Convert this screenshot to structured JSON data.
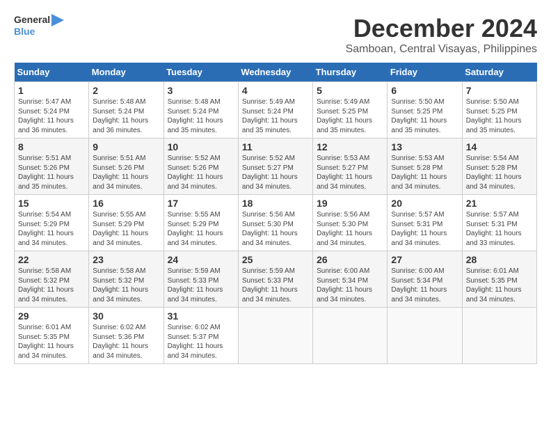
{
  "logo": {
    "text_general": "General",
    "text_blue": "Blue"
  },
  "header": {
    "title": "December 2024",
    "subtitle": "Samboan, Central Visayas, Philippines"
  },
  "calendar": {
    "days_of_week": [
      "Sunday",
      "Monday",
      "Tuesday",
      "Wednesday",
      "Thursday",
      "Friday",
      "Saturday"
    ],
    "weeks": [
      [
        {
          "day": "",
          "info": ""
        },
        {
          "day": "2",
          "info": "Sunrise: 5:48 AM\nSunset: 5:24 PM\nDaylight: 11 hours\nand 36 minutes."
        },
        {
          "day": "3",
          "info": "Sunrise: 5:48 AM\nSunset: 5:24 PM\nDaylight: 11 hours\nand 35 minutes."
        },
        {
          "day": "4",
          "info": "Sunrise: 5:49 AM\nSunset: 5:24 PM\nDaylight: 11 hours\nand 35 minutes."
        },
        {
          "day": "5",
          "info": "Sunrise: 5:49 AM\nSunset: 5:25 PM\nDaylight: 11 hours\nand 35 minutes."
        },
        {
          "day": "6",
          "info": "Sunrise: 5:50 AM\nSunset: 5:25 PM\nDaylight: 11 hours\nand 35 minutes."
        },
        {
          "day": "7",
          "info": "Sunrise: 5:50 AM\nSunset: 5:25 PM\nDaylight: 11 hours\nand 35 minutes."
        }
      ],
      [
        {
          "day": "1",
          "info": "Sunrise: 5:47 AM\nSunset: 5:24 PM\nDaylight: 11 hours\nand 36 minutes."
        },
        {
          "day": "8",
          "info": "Sunrise: 5:51 AM\nSunset: 5:26 PM\nDaylight: 11 hours\nand 35 minutes."
        },
        {
          "day": "9",
          "info": "Sunrise: 5:51 AM\nSunset: 5:26 PM\nDaylight: 11 hours\nand 34 minutes."
        },
        {
          "day": "10",
          "info": "Sunrise: 5:52 AM\nSunset: 5:26 PM\nDaylight: 11 hours\nand 34 minutes."
        },
        {
          "day": "11",
          "info": "Sunrise: 5:52 AM\nSunset: 5:27 PM\nDaylight: 11 hours\nand 34 minutes."
        },
        {
          "day": "12",
          "info": "Sunrise: 5:53 AM\nSunset: 5:27 PM\nDaylight: 11 hours\nand 34 minutes."
        },
        {
          "day": "13",
          "info": "Sunrise: 5:53 AM\nSunset: 5:28 PM\nDaylight: 11 hours\nand 34 minutes."
        },
        {
          "day": "14",
          "info": "Sunrise: 5:54 AM\nSunset: 5:28 PM\nDaylight: 11 hours\nand 34 minutes."
        }
      ],
      [
        {
          "day": "15",
          "info": "Sunrise: 5:54 AM\nSunset: 5:29 PM\nDaylight: 11 hours\nand 34 minutes."
        },
        {
          "day": "16",
          "info": "Sunrise: 5:55 AM\nSunset: 5:29 PM\nDaylight: 11 hours\nand 34 minutes."
        },
        {
          "day": "17",
          "info": "Sunrise: 5:55 AM\nSunset: 5:29 PM\nDaylight: 11 hours\nand 34 minutes."
        },
        {
          "day": "18",
          "info": "Sunrise: 5:56 AM\nSunset: 5:30 PM\nDaylight: 11 hours\nand 34 minutes."
        },
        {
          "day": "19",
          "info": "Sunrise: 5:56 AM\nSunset: 5:30 PM\nDaylight: 11 hours\nand 34 minutes."
        },
        {
          "day": "20",
          "info": "Sunrise: 5:57 AM\nSunset: 5:31 PM\nDaylight: 11 hours\nand 34 minutes."
        },
        {
          "day": "21",
          "info": "Sunrise: 5:57 AM\nSunset: 5:31 PM\nDaylight: 11 hours\nand 33 minutes."
        }
      ],
      [
        {
          "day": "22",
          "info": "Sunrise: 5:58 AM\nSunset: 5:32 PM\nDaylight: 11 hours\nand 34 minutes."
        },
        {
          "day": "23",
          "info": "Sunrise: 5:58 AM\nSunset: 5:32 PM\nDaylight: 11 hours\nand 34 minutes."
        },
        {
          "day": "24",
          "info": "Sunrise: 5:59 AM\nSunset: 5:33 PM\nDaylight: 11 hours\nand 34 minutes."
        },
        {
          "day": "25",
          "info": "Sunrise: 5:59 AM\nSunset: 5:33 PM\nDaylight: 11 hours\nand 34 minutes."
        },
        {
          "day": "26",
          "info": "Sunrise: 6:00 AM\nSunset: 5:34 PM\nDaylight: 11 hours\nand 34 minutes."
        },
        {
          "day": "27",
          "info": "Sunrise: 6:00 AM\nSunset: 5:34 PM\nDaylight: 11 hours\nand 34 minutes."
        },
        {
          "day": "28",
          "info": "Sunrise: 6:01 AM\nSunset: 5:35 PM\nDaylight: 11 hours\nand 34 minutes."
        }
      ],
      [
        {
          "day": "29",
          "info": "Sunrise: 6:01 AM\nSunset: 5:35 PM\nDaylight: 11 hours\nand 34 minutes."
        },
        {
          "day": "30",
          "info": "Sunrise: 6:02 AM\nSunset: 5:36 PM\nDaylight: 11 hours\nand 34 minutes."
        },
        {
          "day": "31",
          "info": "Sunrise: 6:02 AM\nSunset: 5:37 PM\nDaylight: 11 hours\nand 34 minutes."
        },
        {
          "day": "",
          "info": ""
        },
        {
          "day": "",
          "info": ""
        },
        {
          "day": "",
          "info": ""
        },
        {
          "day": "",
          "info": ""
        }
      ]
    ]
  }
}
